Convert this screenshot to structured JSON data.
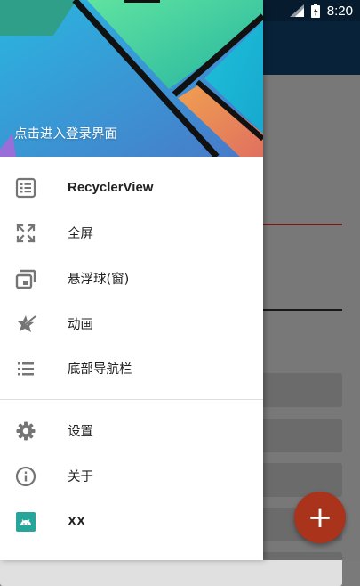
{
  "status_bar": {
    "time": "8:20"
  },
  "drawer": {
    "header_title": "点击进入登录界面",
    "items": [
      {
        "label": "RecyclerView",
        "icon": "list-alt-icon"
      },
      {
        "label": "全屏",
        "icon": "fullscreen-icon"
      },
      {
        "label": "悬浮球(窗)",
        "icon": "picture-in-picture-icon"
      },
      {
        "label": "动画",
        "icon": "animation-icon"
      },
      {
        "label": "底部导航栏",
        "icon": "list-icon"
      },
      {
        "label": "设置",
        "icon": "gear-icon"
      },
      {
        "label": "关于",
        "icon": "info-icon"
      },
      {
        "label": "XX",
        "icon": "android-icon"
      }
    ]
  },
  "fab": {
    "label": "+",
    "color": "#a9331b"
  },
  "colors": {
    "primary": "#12487a",
    "primary_dark": "#0d3c61",
    "accent": "#e53935",
    "icon_gray": "#757575"
  }
}
